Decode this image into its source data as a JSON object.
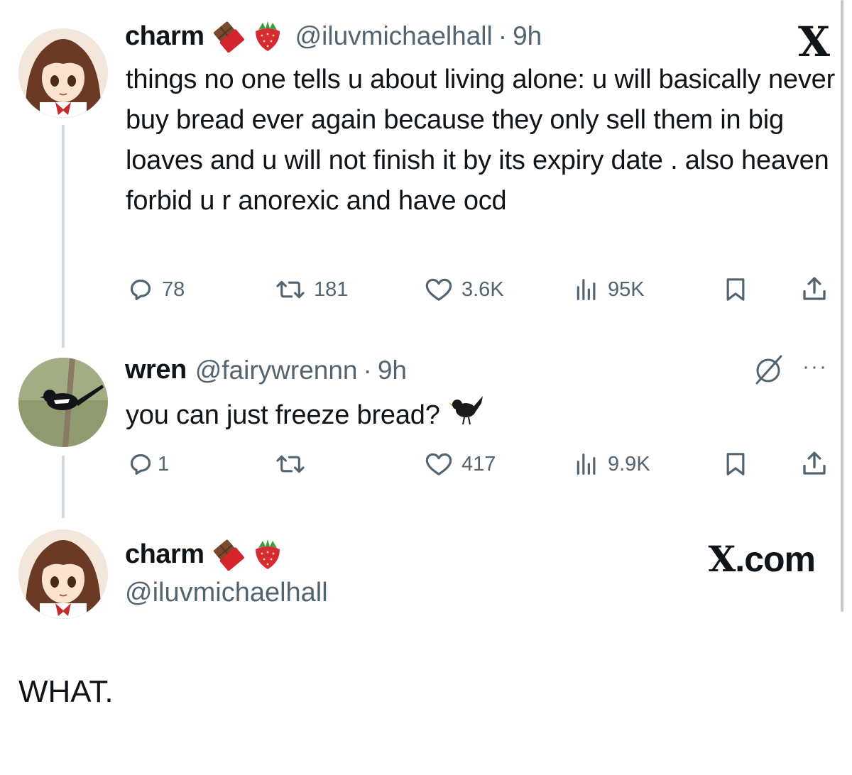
{
  "tweet1": {
    "display_name": "charm",
    "emojis": [
      "chocolate-bar-icon",
      "strawberry-icon"
    ],
    "handle": "@iluvmichaelhall",
    "separator": "·",
    "time": "9h",
    "text": "things no one tells u about living alone: u will basically never buy bread ever again because they only sell them in big loaves and u will not finish it by its expiry date . also heaven forbid u r anorexic and have ocd",
    "replies": "78",
    "reposts": "181",
    "likes": "3.6K",
    "views": "95K",
    "logo": "X"
  },
  "tweet2": {
    "display_name": "wren",
    "handle": "@fairywrennn",
    "separator": "·",
    "time": "9h",
    "text": "you can just freeze bread?",
    "text_emoji": "blackbird-icon",
    "replies": "1",
    "reposts": "",
    "likes": "417",
    "views": "9.9K",
    "more": "···"
  },
  "profile_card": {
    "display_name": "charm",
    "emojis": [
      "chocolate-bar-icon",
      "strawberry-icon"
    ],
    "handle": "@iluvmichaelhall",
    "site_x": "X",
    "site_suffix": ".com"
  },
  "caption": "WHAT.",
  "colors": {
    "text": "#0f1419",
    "secondary": "#536471",
    "thread_line": "#cfd9de"
  }
}
